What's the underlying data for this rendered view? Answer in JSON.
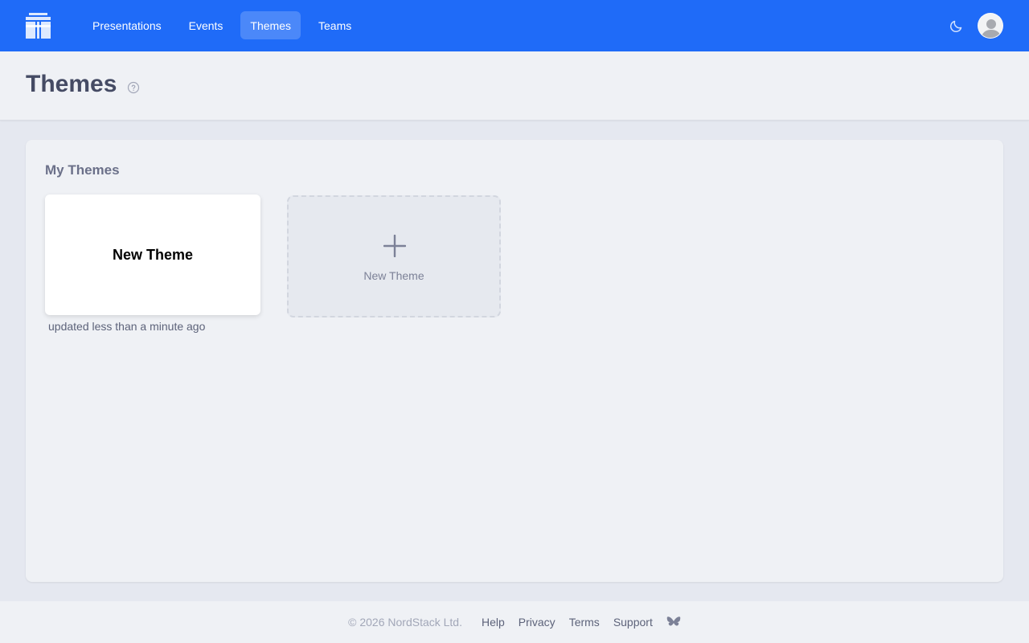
{
  "nav": {
    "items": [
      {
        "label": "Presentations"
      },
      {
        "label": "Events"
      },
      {
        "label": "Themes"
      },
      {
        "label": "Teams"
      }
    ],
    "active": "Themes"
  },
  "icons": {
    "logo": "app-logo",
    "theme_toggle": "moon-icon",
    "avatar": "user-avatar",
    "help": "help-circle-icon",
    "add": "plus-icon",
    "social": "butterfly-icon"
  },
  "header": {
    "title": "Themes"
  },
  "panel": {
    "title": "My Themes",
    "themes": [
      {
        "name": "New Theme",
        "updated": "updated less than a minute ago"
      }
    ],
    "new_card_label": "New Theme"
  },
  "footer": {
    "copyright": "© 2026 NordStack Ltd.",
    "links": [
      "Help",
      "Privacy",
      "Terms",
      "Support"
    ]
  },
  "colors": {
    "brand": "#1f6bf8",
    "background": "#e5e8f0",
    "panel": "#eff1f5"
  }
}
